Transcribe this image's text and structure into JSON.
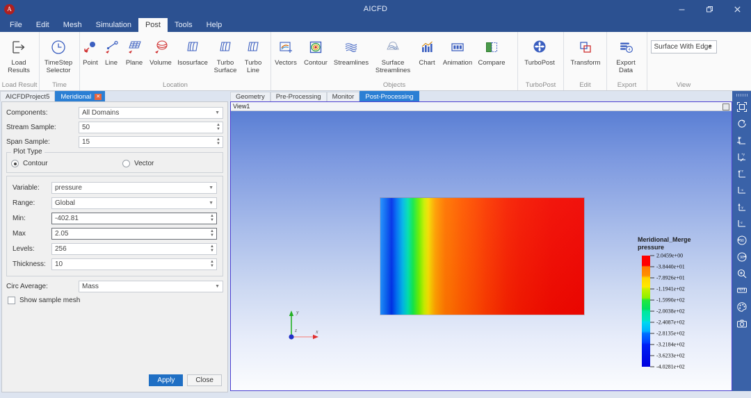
{
  "window": {
    "title": "AICFD",
    "logo_icon": "app-logo-icon",
    "minimize_label": "─",
    "maximize_label": "❐",
    "close_label": "✕"
  },
  "menubar": {
    "items": [
      {
        "label": "File",
        "active": false
      },
      {
        "label": "Edit",
        "active": false
      },
      {
        "label": "Mesh",
        "active": false
      },
      {
        "label": "Simulation",
        "active": false
      },
      {
        "label": "Post",
        "active": true
      },
      {
        "label": "Tools",
        "active": false
      },
      {
        "label": "Help",
        "active": false
      }
    ]
  },
  "ribbon": {
    "groups": [
      {
        "label": "Load Result",
        "buttons": [
          {
            "label": "Load\nResults",
            "icon": "load-results-icon"
          }
        ]
      },
      {
        "label": "Time",
        "buttons": [
          {
            "label": "TimeStep\nSelector",
            "icon": "timestep-selector-icon"
          }
        ]
      },
      {
        "label": "Location",
        "buttons": [
          {
            "label": "Point",
            "icon": "point-icon"
          },
          {
            "label": "Line",
            "icon": "line-icon"
          },
          {
            "label": "Plane",
            "icon": "plane-icon"
          },
          {
            "label": "Volume",
            "icon": "volume-icon"
          },
          {
            "label": "Isosurface",
            "icon": "isosurface-icon"
          },
          {
            "label": "Turbo\nSurface",
            "icon": "turbo-surface-icon"
          },
          {
            "label": "Turbo\nLine",
            "icon": "turbo-line-icon"
          }
        ]
      },
      {
        "label": "Objects",
        "buttons": [
          {
            "label": "Vectors",
            "icon": "vectors-icon"
          },
          {
            "label": "Contour",
            "icon": "contour-icon"
          },
          {
            "label": "Streamlines",
            "icon": "streamlines-icon"
          },
          {
            "label": "Surface\nStreamlines",
            "icon": "surface-streamlines-icon"
          },
          {
            "label": "Chart",
            "icon": "chart-icon"
          },
          {
            "label": "Animation",
            "icon": "animation-icon"
          },
          {
            "label": "Compare",
            "icon": "compare-icon"
          }
        ]
      },
      {
        "label": "TurboPost",
        "buttons": [
          {
            "label": "TurboPost",
            "icon": "turbopost-icon"
          }
        ]
      },
      {
        "label": "Edit",
        "buttons": [
          {
            "label": "Transform",
            "icon": "transform-icon"
          }
        ]
      },
      {
        "label": "Export",
        "buttons": [
          {
            "label": "Export\nData",
            "icon": "export-data-icon"
          }
        ]
      }
    ],
    "view_group": {
      "label": "View",
      "select_value": "Surface With Edge"
    }
  },
  "left_dock": {
    "tabs": [
      {
        "label": "AICFDProject5",
        "active": false,
        "closable": false
      },
      {
        "label": "Meridional",
        "active": true,
        "closable": true,
        "close_label": "✕"
      }
    ],
    "fields": {
      "components": {
        "label": "Components:",
        "value": "All Domains"
      },
      "stream_sample": {
        "label": "Stream Sample:",
        "value": "50"
      },
      "span_sample": {
        "label": "Span Sample:",
        "value": "15"
      }
    },
    "plot_type": {
      "legend": "Plot Type",
      "options": [
        {
          "label": "Contour",
          "selected": true
        },
        {
          "label": "Vector",
          "selected": false
        }
      ]
    },
    "contour_settings": {
      "variable": {
        "label": "Variable:",
        "value": "pressure"
      },
      "range": {
        "label": "Range:",
        "value": "Global"
      },
      "min": {
        "label": "Min:",
        "value": "-402.81"
      },
      "max": {
        "label": "Max",
        "value": "2.05"
      },
      "levels": {
        "label": "Levels:",
        "value": "256"
      },
      "thickness": {
        "label": "Thickness:",
        "value": "10"
      }
    },
    "circ_average": {
      "label": "Circ Average:",
      "value": "Mass"
    },
    "show_sample_mesh": {
      "label": "Show sample mesh",
      "checked": false
    },
    "buttons": {
      "apply": "Apply",
      "close": "Close"
    }
  },
  "view_tabs": [
    {
      "label": "Geometry",
      "active": false
    },
    {
      "label": "Pre-Processing",
      "active": false
    },
    {
      "label": "Monitor",
      "active": false
    },
    {
      "label": "Post-Processing",
      "active": true
    }
  ],
  "viewport": {
    "header_title": "View1",
    "maximize_icon": "viewport-maximize-icon",
    "axis_triad": {
      "x_label": "x",
      "y_label": "y",
      "z_label": "z",
      "x_color": "#e03030",
      "y_color": "#22b022",
      "z_color": "#2030c8"
    }
  },
  "chart_data": {
    "type": "heatmap",
    "title": "Meridional_Merge",
    "subtitle": "pressure",
    "colormap": "rainbow-jet",
    "legend_position": "right",
    "vmin": -402.81,
    "vmax": 2.05,
    "tick_labels": [
      "2.0459e+00",
      "-3.8440e+01",
      "-7.8926e+01",
      "-1.1941e+02",
      "-1.5990e+02",
      "-2.0038e+02",
      "-2.4087e+02",
      "-2.8135e+02",
      "-3.2184e+02",
      "-3.6233e+02",
      "-4.0281e+02"
    ],
    "tick_values": [
      2.0459,
      -38.44,
      -78.926,
      -119.41,
      -159.9,
      -200.38,
      -240.87,
      -281.35,
      -321.84,
      -362.33,
      -402.81
    ],
    "tick_colors": [
      "#ff0000",
      "#ff7a00",
      "#ffd400",
      "#c8f000",
      "#22e83c",
      "#00e060",
      "#00e89a",
      "#00d8f0",
      "#0070ff",
      "#0020f5",
      "#0000e0"
    ],
    "xlabel": "",
    "ylabel": "",
    "grid": false,
    "description": "Meridional contour plot of pressure: low pressure (blue, approx -402 Pa) at the leading/left edge rising steeply through green and yellow to high pressure (red, near 2.05 Pa) across the remaining span."
  },
  "vertical_toolbar": {
    "tools": [
      {
        "icon": "fit-view-icon",
        "title": "Fit View"
      },
      {
        "icon": "rotate-view-icon",
        "title": "Rotate"
      },
      {
        "icon": "view-plus-x-icon",
        "title": "+X View"
      },
      {
        "icon": "view-plus-y-icon",
        "title": "+Y View"
      },
      {
        "icon": "view-plus-z-icon",
        "title": "+Z View"
      },
      {
        "icon": "view-minus-x-icon",
        "title": "-X View"
      },
      {
        "icon": "view-minus-y-icon",
        "title": "-Y View"
      },
      {
        "icon": "view-minus-z-icon",
        "title": "-Z View"
      },
      {
        "icon": "rotate-ccw-90-icon",
        "title": "Rotate 90 CCW"
      },
      {
        "icon": "rotate-cw-90-icon",
        "title": "Rotate 90 CW"
      },
      {
        "icon": "zoom-box-icon",
        "title": "Zoom Box"
      },
      {
        "icon": "ruler-icon",
        "title": "Measure"
      },
      {
        "icon": "palette-icon",
        "title": "Colors"
      },
      {
        "icon": "camera-icon",
        "title": "Screenshot"
      }
    ]
  }
}
